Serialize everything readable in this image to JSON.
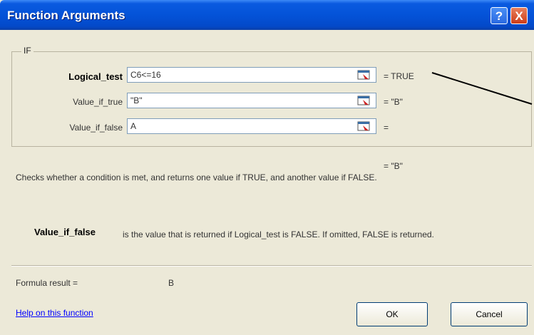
{
  "window": {
    "title": "Function Arguments",
    "help_button": "?",
    "close_button": "X"
  },
  "function_group": {
    "name": "IF",
    "arguments": [
      {
        "label": "Logical_test",
        "value": "C6<=16",
        "result": "= TRUE"
      },
      {
        "label": "Value_if_true",
        "value": "\"B\"",
        "result": "= \"B\""
      },
      {
        "label": "Value_if_false",
        "value": "A",
        "result": "="
      }
    ]
  },
  "function_result": "= \"B\"",
  "description": "Checks whether a condition is met, and returns one value if TRUE, and another value if FALSE.",
  "argument_help": {
    "name": "Value_if_false",
    "text": "is the value that is returned if Logical_test is FALSE. If omitted, FALSE is returned."
  },
  "formula_result": {
    "label": "Formula result =",
    "value": "B"
  },
  "help_link": "Help on this function",
  "buttons": {
    "ok": "OK",
    "cancel": "Cancel"
  },
  "icons": {
    "collapse": "collapse-dialog-icon",
    "help": "question-mark-icon",
    "close": "close-icon"
  }
}
